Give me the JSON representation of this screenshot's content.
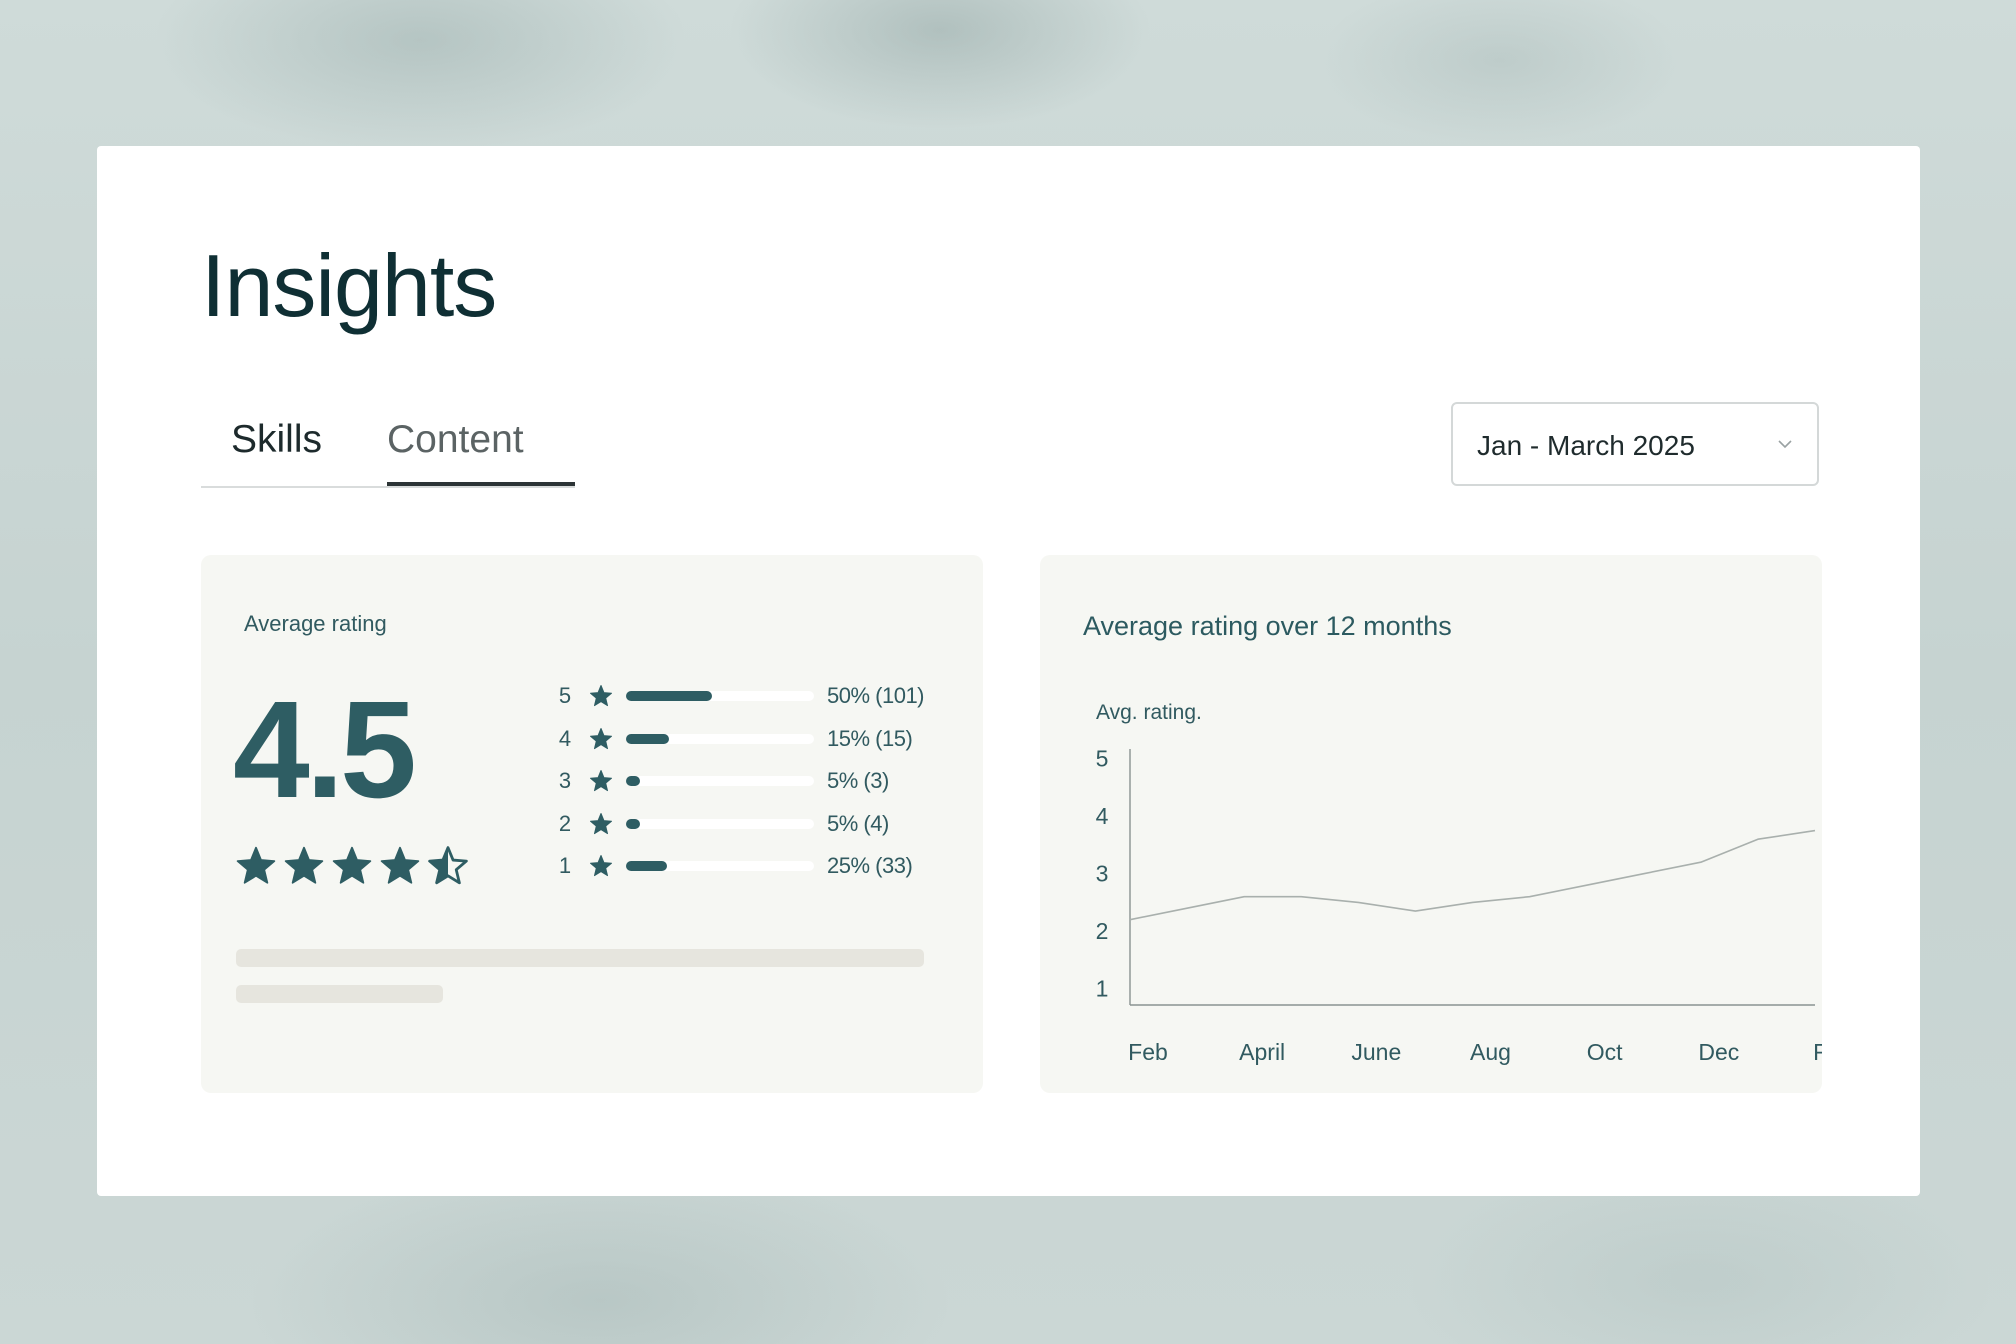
{
  "page": {
    "title": "Insights",
    "tabs": [
      {
        "label": "Skills",
        "selected": false
      },
      {
        "label": "Content",
        "selected": true
      }
    ],
    "date_range": {
      "value": "Jan - March 2025",
      "icon": "chevron-down-icon"
    }
  },
  "rating_card": {
    "label": "Average rating",
    "value": "4.5",
    "stars_filled": 4,
    "stars_half": 1,
    "breakdown": [
      {
        "stars": "5",
        "percent_label": "50% (101)",
        "fill": 0.46
      },
      {
        "stars": "4",
        "percent_label": "15% (15)",
        "fill": 0.23
      },
      {
        "stars": "3",
        "percent_label": "5% (3)",
        "fill": 0.07
      },
      {
        "stars": "2",
        "percent_label": "5% (4)",
        "fill": 0.07
      },
      {
        "stars": "1",
        "percent_label": "25% (33)",
        "fill": 0.22
      }
    ]
  },
  "trend_card": {
    "title": "Average rating over 12 months"
  },
  "colors": {
    "accent": "#2e5d63",
    "text_dark": "#0f2f34",
    "panel_bg": "#f6f7f3",
    "line": "#a9b0ad"
  },
  "chart_data": {
    "type": "line",
    "ylabel": "Avg. rating.",
    "ylim": [
      0.75,
      5.1
    ],
    "yticks": [
      "1",
      "2",
      "3",
      "4",
      "5"
    ],
    "tick_labels": [
      "Feb",
      "April",
      "June",
      "Aug",
      "Oct",
      "Dec",
      "Feb"
    ],
    "x": [
      0,
      1,
      2,
      3,
      4,
      5,
      6,
      7,
      8,
      9,
      10,
      11,
      12
    ],
    "series": [
      {
        "values": [
          2.2,
          2.4,
          2.6,
          2.6,
          2.5,
          2.35,
          2.5,
          2.6,
          2.8,
          3.0,
          3.2,
          3.6,
          3.75
        ]
      }
    ],
    "grid": false
  }
}
